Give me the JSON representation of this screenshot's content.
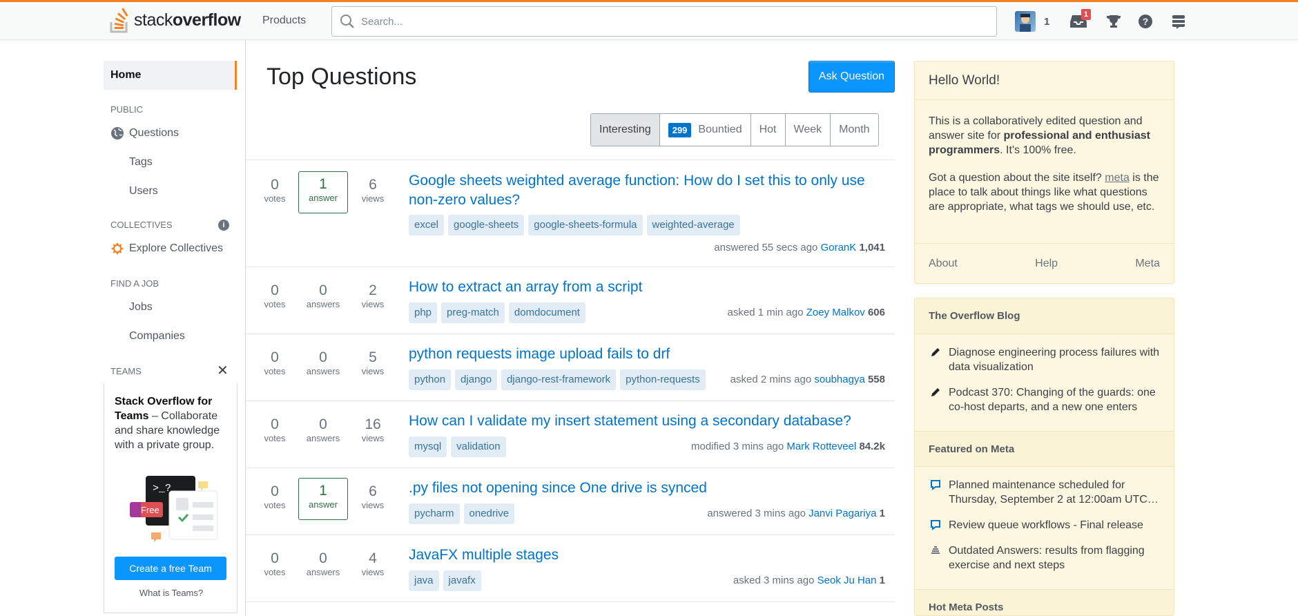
{
  "topbar": {
    "logo_light": "stack",
    "logo_bold": "overflow",
    "products": "Products",
    "search_placeholder": "Search...",
    "reputation": "1",
    "inbox_count": "1"
  },
  "leftnav": {
    "home": "Home",
    "public": "PUBLIC",
    "questions": "Questions",
    "tags": "Tags",
    "users": "Users",
    "collectives": "COLLECTIVES",
    "explore_collectives": "Explore Collectives",
    "find_job": "FIND A JOB",
    "jobs": "Jobs",
    "companies": "Companies",
    "teams": "TEAMS",
    "teams_title": "Stack Overflow for Teams",
    "teams_desc": " – Collaborate and share knowledge with a private group.",
    "free_badge": "Free",
    "create_team": "Create a free Team",
    "what_teams": "What is Teams?"
  },
  "main": {
    "title": "Top Questions",
    "ask_button": "Ask Question",
    "filters": {
      "interesting": "Interesting",
      "bounty_count": "299",
      "bountied": "Bountied",
      "hot": "Hot",
      "week": "Week",
      "month": "Month"
    },
    "questions": [
      {
        "votes": "0",
        "votes_label": "votes",
        "answers": "1",
        "answers_label": "answer",
        "views": "6",
        "views_label": "views",
        "title": "Google sheets weighted average function: How do I set this to only use non-zero values?",
        "tags": [
          "excel",
          "google-sheets",
          "google-sheets-formula",
          "weighted-average"
        ],
        "action": "answered 55 secs ago",
        "user": "GoranK",
        "rep": "1,041"
      },
      {
        "votes": "0",
        "votes_label": "votes",
        "answers": "0",
        "answers_label": "answers",
        "views": "2",
        "views_label": "views",
        "title": "How to extract an array from a script",
        "tags": [
          "php",
          "preg-match",
          "domdocument"
        ],
        "action": "asked 1 min ago",
        "user": "Zoey Malkov",
        "rep": "606"
      },
      {
        "votes": "0",
        "votes_label": "votes",
        "answers": "0",
        "answers_label": "answers",
        "views": "5",
        "views_label": "views",
        "title": "python requests image upload fails to drf",
        "tags": [
          "python",
          "django",
          "django-rest-framework",
          "python-requests"
        ],
        "action": "asked 2 mins ago",
        "user": "soubhagya",
        "rep": "558"
      },
      {
        "votes": "0",
        "votes_label": "votes",
        "answers": "0",
        "answers_label": "answers",
        "views": "16",
        "views_label": "views",
        "title": "How can I validate my insert statement using a secondary database?",
        "tags": [
          "mysql",
          "validation"
        ],
        "action": "modified 3 mins ago",
        "user": "Mark Rotteveel",
        "rep": "84.2k"
      },
      {
        "votes": "0",
        "votes_label": "votes",
        "answers": "1",
        "answers_label": "answer",
        "views": "6",
        "views_label": "views",
        "title": ".py files not opening since One drive is synced",
        "tags": [
          "pycharm",
          "onedrive"
        ],
        "action": "answered 3 mins ago",
        "user": "Janvi Pagariya",
        "rep": "1"
      },
      {
        "votes": "0",
        "votes_label": "votes",
        "answers": "0",
        "answers_label": "answers",
        "views": "4",
        "views_label": "views",
        "title": "JavaFX multiple stages",
        "tags": [
          "java",
          "javafx"
        ],
        "action": "asked 3 mins ago",
        "user": "Seok Ju Han",
        "rep": "1"
      }
    ]
  },
  "hello": {
    "title": "Hello World!",
    "p1_a": "This is a collaboratively edited question and answer site for ",
    "p1_b": "professional and enthusiast programmers",
    "p1_c": ". It's 100% free.",
    "p2_a": "Got a question about the site itself? ",
    "p2_link": "meta",
    "p2_b": " is the place to talk about things like what questions are appropriate, what tags we should use, etc.",
    "about": "About",
    "help": "Help",
    "meta": "Meta"
  },
  "blog": {
    "blog_title": "The Overflow Blog",
    "blog_items": [
      "Diagnose engineering process failures with data visualization",
      "Podcast 370: Changing of the guards: one co-host departs, and a new one enters"
    ],
    "featured_title": "Featured on Meta",
    "featured_items": [
      "Planned maintenance scheduled for Thursday, September 2 at 12:00am UTC…",
      "Review queue workflows - Final release",
      "Outdated Answers: results from flagging exercise and next steps"
    ],
    "hot_meta_title": "Hot Meta Posts"
  }
}
